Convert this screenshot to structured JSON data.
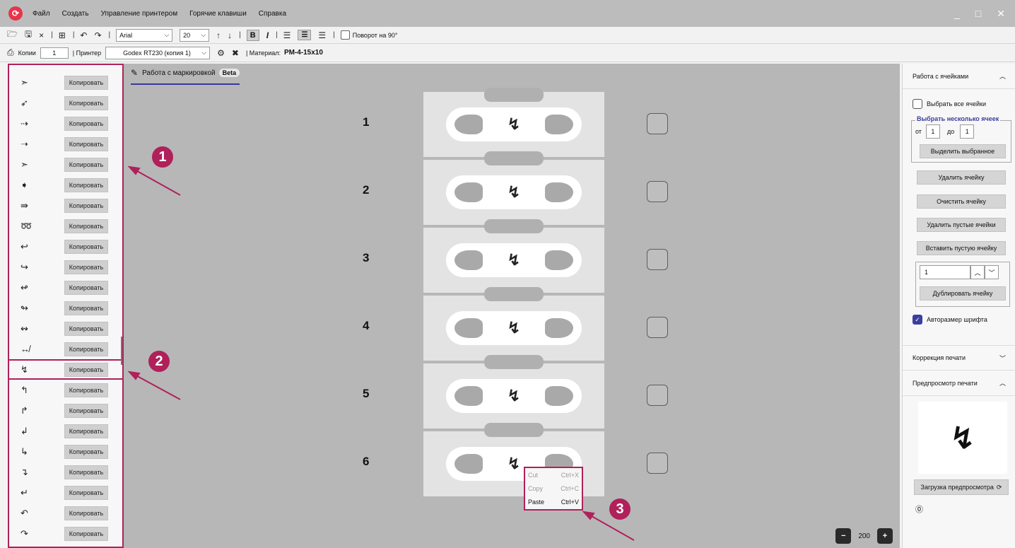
{
  "menu": [
    "Файл",
    "Создать",
    "Управление принтером",
    "Горячие клавиши",
    "Справка"
  ],
  "toolbar1": {
    "font": "Arial",
    "size": "20",
    "bold_label": "B",
    "italic_label": "I",
    "rotate_label": "Поворот на 90°"
  },
  "toolbar2": {
    "copies_label": "Копии",
    "copies_value": "1",
    "printer_label": "| Принтер",
    "printer_value": "Godex RT230 (копия 1)",
    "material_label": "| Материал:",
    "material_value": "РМ-4-15x10"
  },
  "left_panel": {
    "copy_label": "Копировать",
    "symbols": [
      "➣",
      "➶",
      "⇢",
      "➝",
      "➣",
      "➧",
      "⇛",
      "➿",
      "↩",
      "↪",
      "↫",
      "↬",
      "↭",
      "↮",
      "↯",
      "↰",
      "↱",
      "↲",
      "↳",
      "↴",
      "↵",
      "↶",
      "↷"
    ]
  },
  "canvas": {
    "tab_label": "Работа с маркировкой",
    "tab_badge": "Beta",
    "cells": [
      {
        "num": "1",
        "symbol": "↯"
      },
      {
        "num": "2",
        "symbol": "↯"
      },
      {
        "num": "3",
        "symbol": "↯"
      },
      {
        "num": "4",
        "symbol": "↯"
      },
      {
        "num": "5",
        "symbol": "↯"
      },
      {
        "num": "6",
        "symbol": "↯"
      }
    ],
    "context_menu": [
      {
        "label": "Cut",
        "shortcut": "Ctrl+X"
      },
      {
        "label": "Copy",
        "shortcut": "Ctrl+C"
      },
      {
        "label": "Paste",
        "shortcut": "Ctrl+V"
      }
    ],
    "zoom": "200"
  },
  "badges": [
    "1",
    "2",
    "3"
  ],
  "right_panel": {
    "cells_header": "Работа с ячейками",
    "select_all": "Выбрать все ячейки",
    "select_several": "Выбрать несколько ячеек",
    "from_label": "от",
    "from_value": "1",
    "to_label": "до",
    "to_value": "1",
    "highlight_selected": "Выделить выбранное",
    "delete_cell": "Удалить ячейку",
    "clear_cell": "Очистить ячейку",
    "delete_empty": "Удалить пустые ячейки",
    "insert_empty": "Вставить пустую ячейку",
    "dup_value": "1",
    "duplicate_cell": "Дублировать ячейку",
    "autosize_font": "Авторазмер шрифта",
    "print_correction": "Коррекция печати",
    "print_preview": "Предпросмотр печати",
    "preview_symbol": "↯",
    "load_preview": "Загрузка предпросмотра"
  },
  "colors": {
    "accent": "#b0205a",
    "brand": "#3b3ea0"
  }
}
